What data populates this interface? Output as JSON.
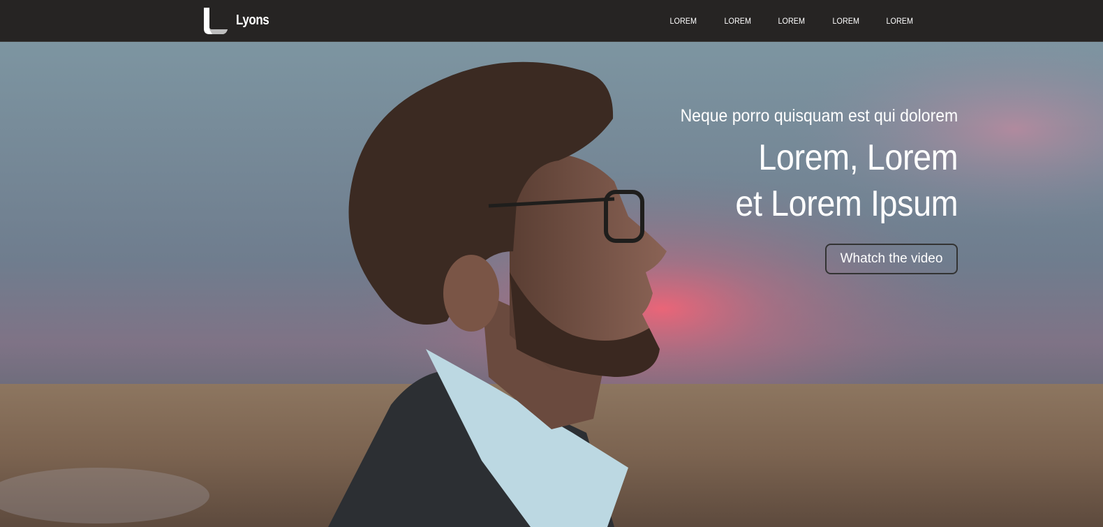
{
  "brand": {
    "name": "Lyons"
  },
  "nav": {
    "items": [
      {
        "label": "LOREM"
      },
      {
        "label": "LOREM"
      },
      {
        "label": "LOREM"
      },
      {
        "label": "LOREM"
      },
      {
        "label": "LOREM"
      }
    ]
  },
  "hero": {
    "eyebrow": "Neque porro quisquam est qui dolorem",
    "headline_line1": "Lorem, Lorem",
    "headline_line2": "et Lorem Ipsum",
    "cta_label": "Whatch the video"
  },
  "colors": {
    "navbar": "#262423",
    "text": "#ffffff",
    "cta_border": "#333333"
  }
}
